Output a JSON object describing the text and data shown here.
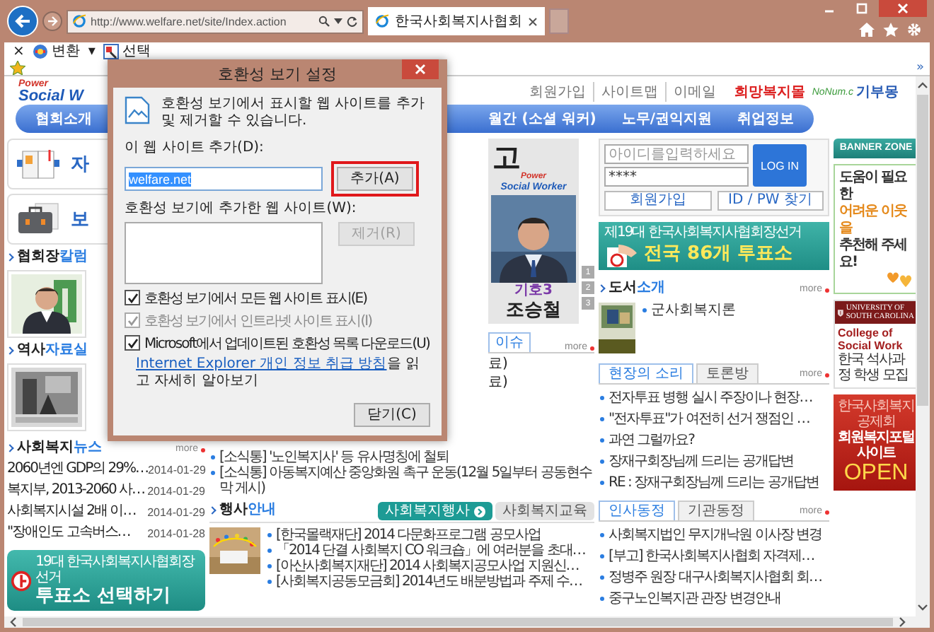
{
  "browser": {
    "address": "http://www.welfare.net/site/Index.action",
    "tabs": [
      {
        "title": "한국사회복지사협회",
        "selected": true
      }
    ],
    "command_bar": {
      "close": "×",
      "items": [
        {
          "kind": "convert",
          "label": "변환"
        },
        {
          "kind": "dropdown",
          "label": "▾"
        },
        {
          "kind": "select",
          "label": "선택"
        }
      ]
    },
    "favorites_more": "»"
  },
  "page": {
    "header": {
      "logo": {
        "top": "Power",
        "bottom": "Social W"
      },
      "links": [
        "회원가입",
        "사이트맵",
        "이메일"
      ],
      "mall": "희망복지몰",
      "nanum": {
        "brand": "NoNum.c",
        "label": "기부몽"
      }
    },
    "nav": {
      "left": [
        "협회소개"
      ],
      "right": [
        "월간 (소셜 워커)",
        "노무/권익지원",
        "취업정보"
      ]
    },
    "left": {
      "cards": [
        {
          "kind": "planner",
          "initial": "자"
        },
        {
          "kind": "briefcase",
          "initial": "보"
        }
      ],
      "column": {
        "dark": "협회장",
        "accent": "칼럼"
      },
      "history": {
        "dark": "역사",
        "accent": "자료실"
      },
      "news": {
        "heading": {
          "dark": "사회복지",
          "accent": "뉴스"
        },
        "more": "more",
        "items": [
          {
            "title": "2060년엔 GDP의 29%…",
            "date": "2014-01-29"
          },
          {
            "title": "복지부, 2013-2060 사…",
            "date": "2014-01-29"
          },
          {
            "title": "사회복지시설 2배 이…",
            "date": "2014-01-29"
          },
          {
            "title": "\"장애인도 고속버스…",
            "date": "2014-01-28"
          }
        ]
      },
      "vote_banner": {
        "line1": "19대 한국사회복지사협회장 선거",
        "line2": "투표소 선택하기"
      }
    },
    "center": {
      "poster": {
        "slogan": "고",
        "logo_top": "Power",
        "logo_bottom": "Social Worker",
        "number": "기호3",
        "name": "조승철",
        "pages": [
          "1",
          "2",
          "3"
        ]
      },
      "issues": {
        "tab": "이슈",
        "more": "more",
        "fragments": [
          "료)",
          "료)"
        ],
        "items": [
          "[소식통] '노인복지사' 등 유사명칭에 철퇴",
          "[소식통] 아동복지예산 중앙화원 촉구 운동(12월 5일부터 공동현수막 게시)"
        ]
      },
      "events": {
        "heading": {
          "dark": "행사",
          "accent": "안내"
        },
        "tabs": [
          {
            "label": "사회복지행사",
            "selected": true
          },
          {
            "label": "사회복지교육",
            "selected": false
          }
        ],
        "items": [
          "[한국몰랙재단] 2014 다문화프로그램 공모사업",
          "「2014 단결 사회복지 CO 워크숍」에 여러분을 초대…",
          "[아산사회복지재단] 2014 사회복지공모사업 지원신…",
          "[사회복지공동모금회] 2014년도 배분방법과 주제 수…"
        ]
      }
    },
    "right": {
      "login": {
        "id_placeholder": "아이디를입력하세요",
        "password": "****",
        "login": "LOG IN",
        "join": "회원가입",
        "find": "ID / PW 찾기"
      },
      "vote_banner": {
        "caption": "제19대 한국사회복지사협회장선거",
        "headline": "전국 86개 투표소"
      },
      "books": {
        "heading": {
          "dark": "도서",
          "accent": "소개"
        },
        "more": "more",
        "items": [
          "군사회복지론"
        ]
      },
      "voice": {
        "tabs": [
          {
            "label": "현장의 소리",
            "selected": true
          },
          {
            "label": "토론방",
            "selected": false
          }
        ],
        "more": "more",
        "items": [
          "전자투표 병행 실시 주장이나 현장…",
          "\"전자투표\"가 여전히 선거 쟁점인 …",
          "과연 그럴까요?",
          "장재구회장님께 드리는 공개답변",
          "RE : 장재구회장님께 드리는 공개답변"
        ]
      },
      "people": {
        "tabs": [
          {
            "label": "인사동정",
            "selected": true
          },
          {
            "label": "기관동정",
            "selected": false
          }
        ],
        "more": "more",
        "items": [
          "사회복지법인 무지개낙원 이사장 변경",
          "[부고] 한국사회복지사협회 자격제…",
          "정병주 원장 대구사회복지사협회 회…",
          "중구노인복지관 관장 변경안내"
        ]
      }
    },
    "banners": {
      "title": "BANNER ZONE",
      "items": [
        {
          "kind": "help",
          "lines": [
            "도움이 필요한",
            "어려운 이웃을",
            "추천해 주세요!"
          ]
        },
        {
          "kind": "university",
          "lines": [
            "UNIVERSITY OF",
            "SOUTH CAROLINA",
            "College of Social Work",
            "한국 석사과정 학생 모집"
          ]
        },
        {
          "kind": "open",
          "lines": [
            "한국사회복지공제회",
            "회원복지포털사이트",
            "OPEN"
          ]
        }
      ]
    }
  },
  "dialog": {
    "title": "호환성 보기 설정",
    "intro": "호환성 보기에서 표시할 웹 사이트를 추가 및 제거할 수 있습니다.",
    "add_label": "이 웹 사이트 추가(D):",
    "site_value": "welfare.net",
    "value_selected": true,
    "add_button": {
      "label": "추가(A)",
      "highlighted": true
    },
    "list_label": "호환성 보기에 추가한 웹 사이트(W):",
    "remove_button": {
      "label": "제거(R)",
      "disabled": true
    },
    "options": [
      {
        "label": "호환성 보기에서 모든 웹 사이트 표시(E)",
        "checked": true,
        "disabled": false
      },
      {
        "label": "호환성 보기에서 인트라넷 사이트 표시(I)",
        "checked": true,
        "disabled": true
      },
      {
        "label": "Microsoft에서 업데이트된 호환성 목록 다운로드(U)",
        "checked": true,
        "disabled": false
      }
    ],
    "privacy": {
      "link": "Internet Explorer 개인 정보 취급 방침",
      "rest": "을 읽고 자세히 알아보기"
    },
    "close_button": "닫기(C)"
  }
}
